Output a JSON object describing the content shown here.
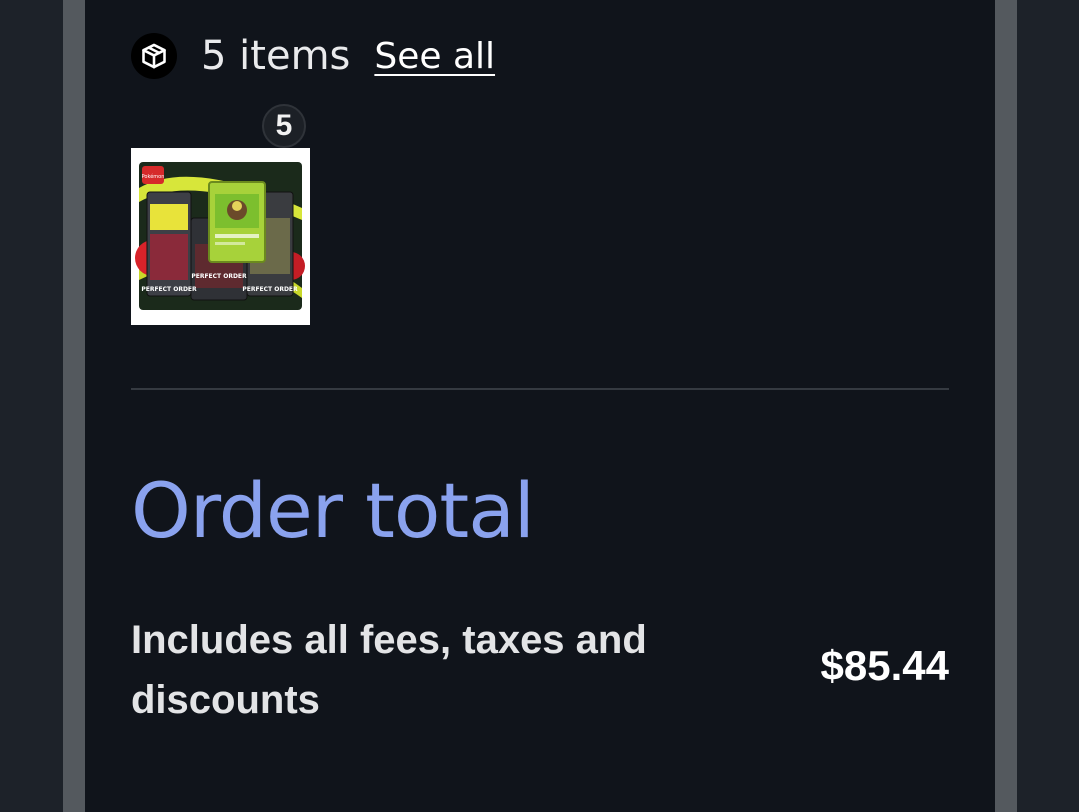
{
  "items_section": {
    "icon": "package-icon",
    "count_label": "5 items",
    "see_all_label": "See all"
  },
  "product": {
    "quantity": "5",
    "image": {
      "brand_text": "Pokémon",
      "pack_text": "PERFECT ORDER"
    }
  },
  "order_total": {
    "title": "Order total",
    "description": "Includes all fees, taxes and discounts",
    "amount": "$85.44"
  },
  "colors": {
    "background": "#10141b",
    "accent_title": "#8aa2ee",
    "text": "#e3e4e6"
  }
}
